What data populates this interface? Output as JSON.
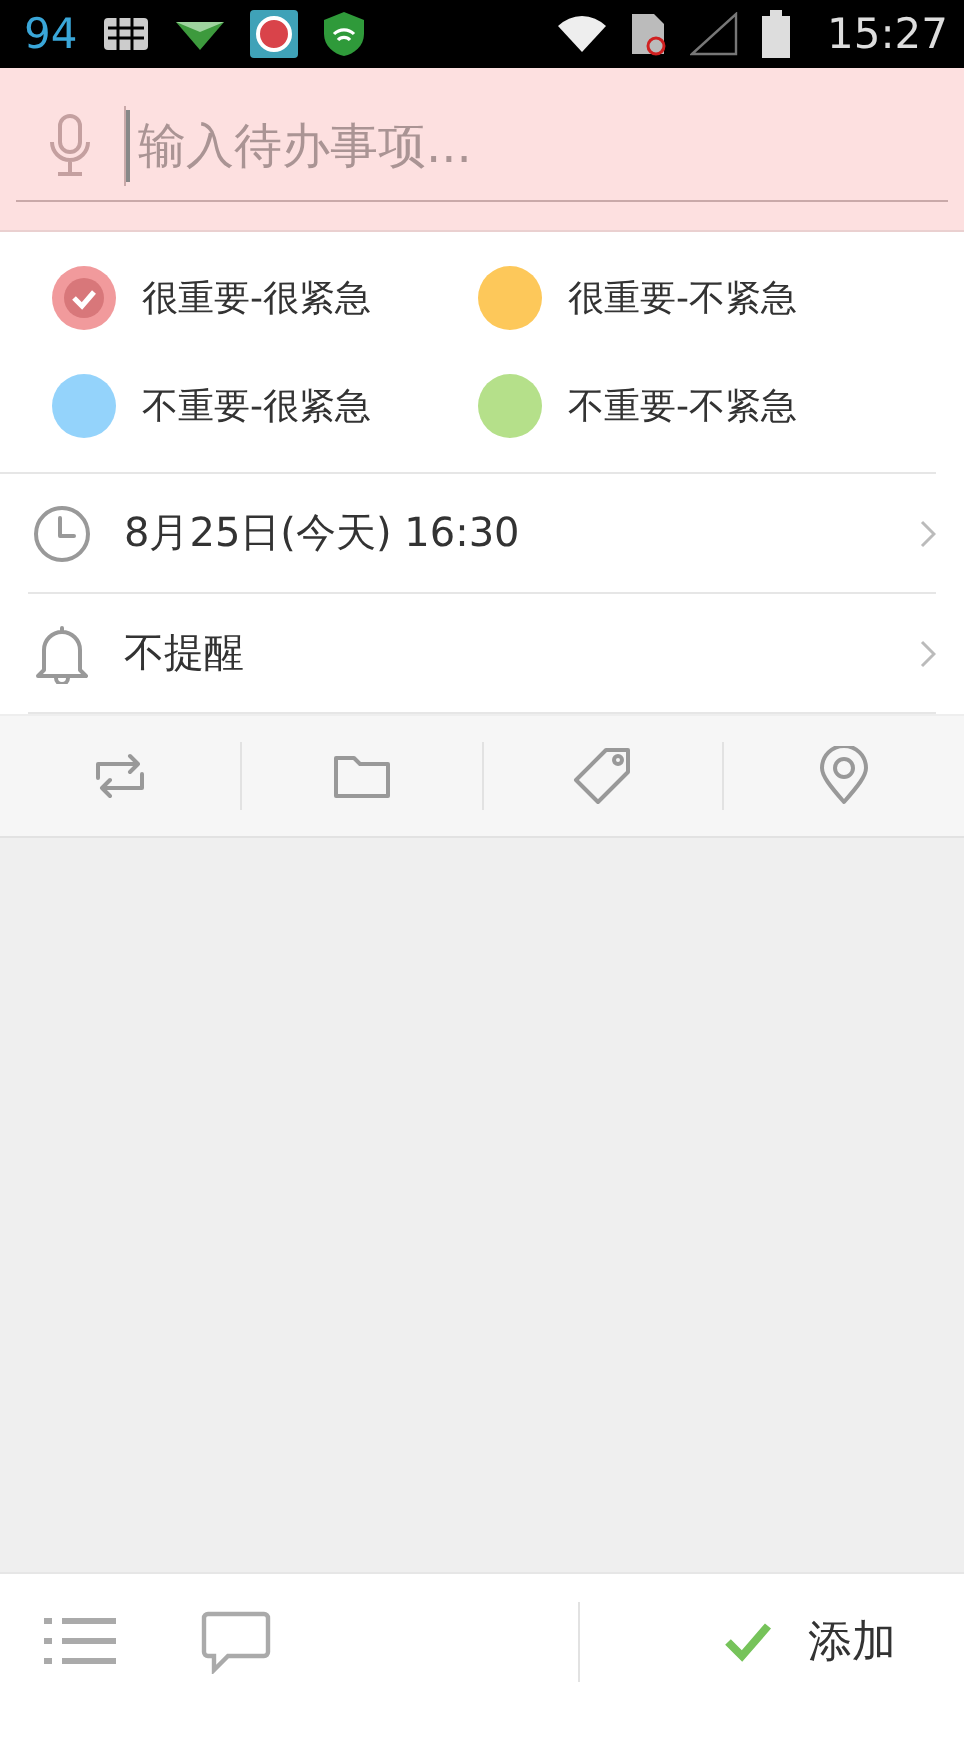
{
  "status_bar": {
    "battery_level_text": "94",
    "time": "15:27"
  },
  "task_input": {
    "placeholder": "输入待办事项..."
  },
  "priorities": [
    {
      "label": "很重要-很紧急",
      "color": "#f19a9c",
      "selected": true
    },
    {
      "label": "很重要-不紧急",
      "color": "#fdc85a",
      "selected": false
    },
    {
      "label": "不重要-很紧急",
      "color": "#94d3fb",
      "selected": false
    },
    {
      "label": "不重要-不紧急",
      "color": "#b5e08a",
      "selected": false
    }
  ],
  "options": [
    {
      "kind": "date",
      "label": "8月25日(今天) 16:30"
    },
    {
      "kind": "reminder",
      "label": "不提醒"
    }
  ],
  "toolbar": [
    {
      "kind": "repeat"
    },
    {
      "kind": "folder"
    },
    {
      "kind": "tag"
    },
    {
      "kind": "location"
    }
  ],
  "bottom_bar": {
    "add_button": "添加"
  }
}
